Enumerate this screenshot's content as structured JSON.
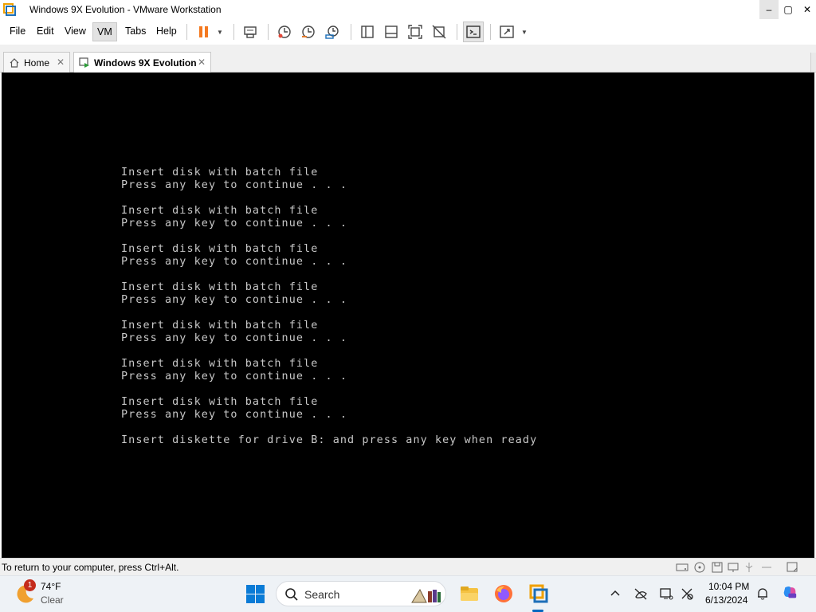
{
  "window": {
    "title": "Windows 9X Evolution - VMware Workstation",
    "buttons": {
      "minimize": "–",
      "maximize": "▢",
      "close": "✕"
    }
  },
  "menu": {
    "items": [
      "File",
      "Edit",
      "View",
      "VM",
      "Tabs",
      "Help"
    ],
    "selected": "VM"
  },
  "toolbar": {
    "icons": [
      "pause-icon",
      "send-ctrl-alt-del-icon",
      "snapshot-icon",
      "revert-snapshot-icon",
      "snapshot-manager-icon",
      "library-icon",
      "thumbnail-icon",
      "full-screen-icon",
      "unity-icon",
      "console-view-icon",
      "stretch-icon"
    ]
  },
  "tabs": [
    {
      "label": "Home",
      "close": "✕",
      "active": false
    },
    {
      "label": "Windows 9X Evolution",
      "close": "✕",
      "active": true
    }
  ],
  "console": {
    "background": "#000000",
    "text_color": "#c8c8c8",
    "blocks": [
      [
        "Insert disk with batch file",
        "Press any key to continue . . ."
      ],
      [
        "Insert disk with batch file",
        "Press any key to continue . . ."
      ],
      [
        "Insert disk with batch file",
        "Press any key to continue . . ."
      ],
      [
        "Insert disk with batch file",
        "Press any key to continue . . ."
      ],
      [
        "Insert disk with batch file",
        "Press any key to continue . . ."
      ],
      [
        "Insert disk with batch file",
        "Press any key to continue . . ."
      ],
      [
        "Insert disk with batch file",
        "Press any key to continue . . ."
      ]
    ],
    "final_line": "Insert diskette for drive B: and press any key when ready"
  },
  "statusbar": {
    "message": "To return to your computer, press Ctrl+Alt.",
    "device_icons": [
      "hard-disk-icon",
      "cd-rom-icon",
      "floppy-icon",
      "network-icon",
      "usb-icon",
      "sound-icon",
      "display-icon",
      "message-icon"
    ]
  },
  "taskbar": {
    "weather": {
      "badge": "1",
      "temp": "74°F",
      "condition": "Clear"
    },
    "search_label": "Search",
    "apps": [
      "file-explorer-icon",
      "firefox-icon",
      "vmware-icon"
    ],
    "tray_icons": [
      "chevron-up-icon",
      "network-off-icon",
      "display-sound-icon",
      "settings-icon",
      "notification-bell-icon",
      "copilot-icon"
    ],
    "time": "10:04 PM",
    "date": "6/13/2024"
  },
  "colors": {
    "accent": "#0067c0",
    "pause": "#f47920",
    "taskbar_bg": "#eef2f6"
  }
}
